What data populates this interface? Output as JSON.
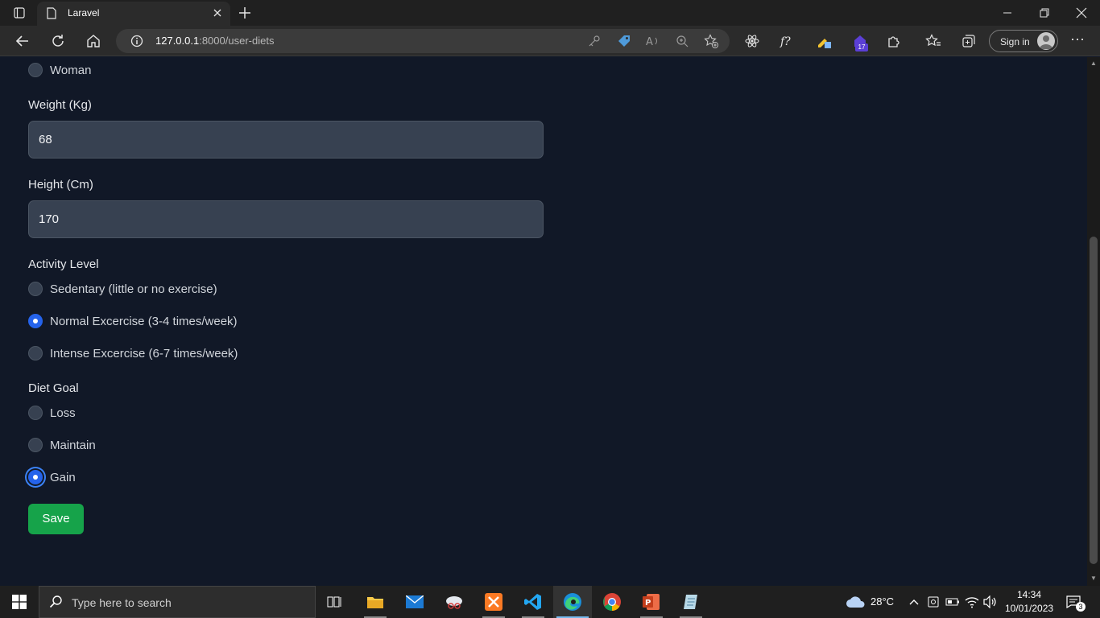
{
  "browser": {
    "tab_title": "Laravel",
    "url_host": "127.0.0.1",
    "url_path": ":8000/user-diets",
    "sign_in_label": "Sign in",
    "extension_badge": "17"
  },
  "form": {
    "gender_option_woman": "Woman",
    "weight_label": "Weight (Kg)",
    "weight_value": "68",
    "height_label": "Height (Cm)",
    "height_value": "170",
    "activity_label": "Activity Level",
    "activity_options": [
      "Sedentary (little or no exercise)",
      "Normal Excercise (3-4 times/week)",
      "Intense Excercise (6-7 times/week)"
    ],
    "activity_selected_index": 1,
    "goal_label": "Diet Goal",
    "goal_options": [
      "Loss",
      "Maintain",
      "Gain"
    ],
    "goal_selected_index": 2,
    "save_label": "Save"
  },
  "taskbar": {
    "search_placeholder": "Type here to search",
    "weather": "28°C",
    "time": "14:34",
    "date": "10/01/2023",
    "notification_count": "3"
  },
  "colors": {
    "page_bg": "#111827",
    "input_bg": "#374151",
    "radio_checked": "#2563eb",
    "save_button": "#16a34a"
  }
}
